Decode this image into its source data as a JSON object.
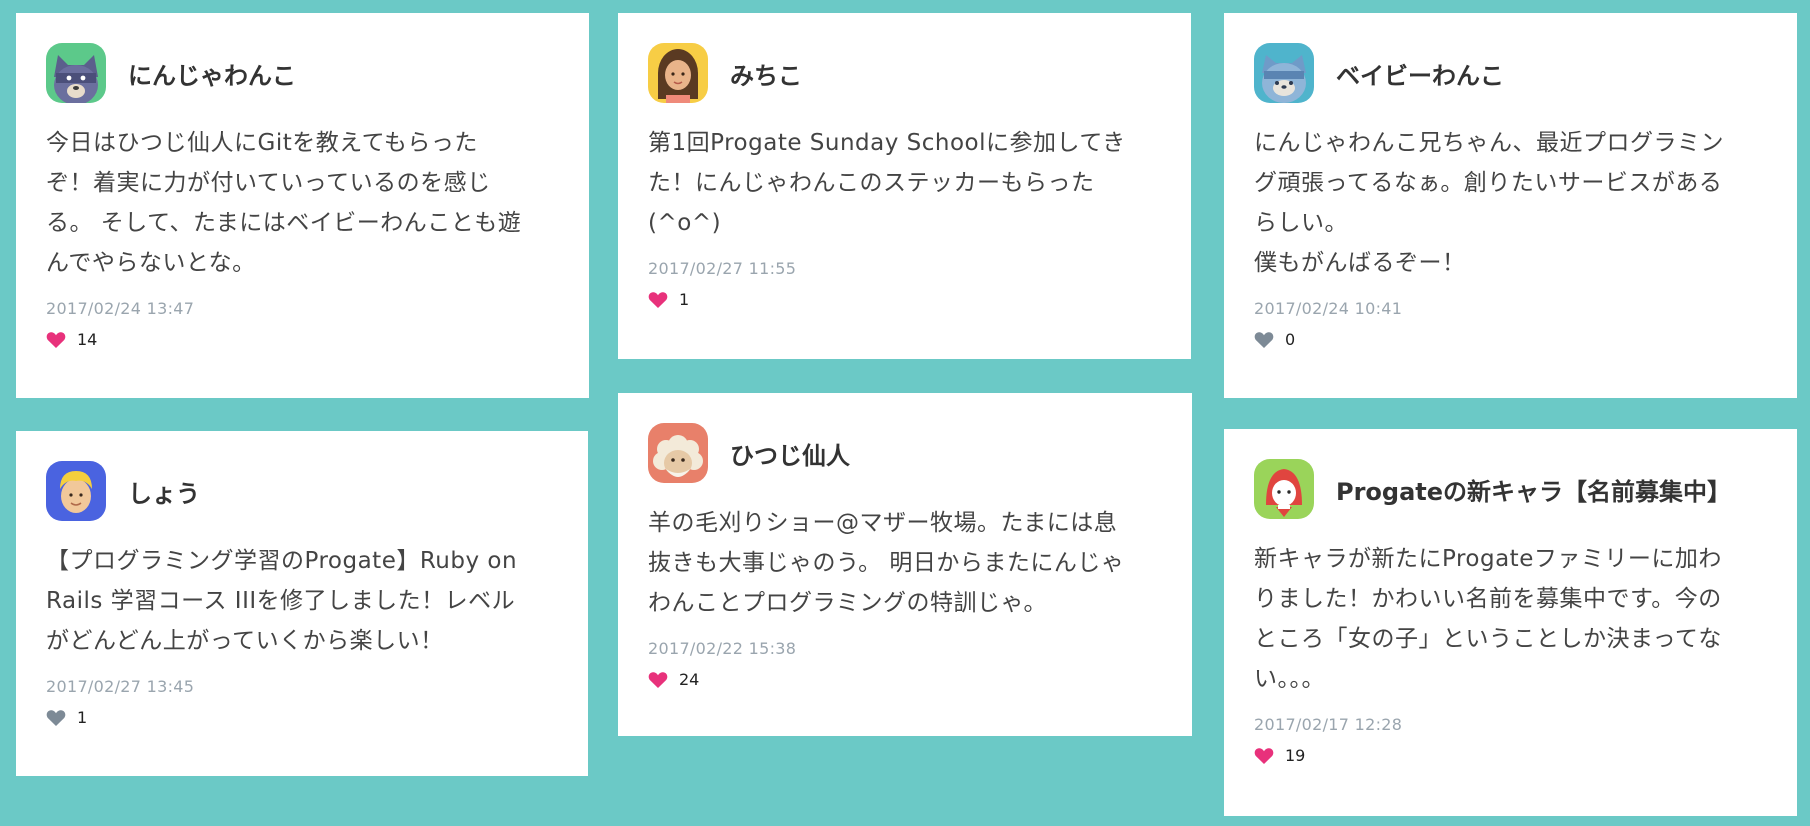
{
  "colors": {
    "background": "#6bc9c6",
    "liked_heart": "#e8317b",
    "unliked_heart": "#7d8a96"
  },
  "posts": [
    {
      "user": "にんじゃわんこ",
      "avatar_icon": "ninja-wanko-icon",
      "body": "今日はひつじ仙人にGitを教えてもらった\nぞ！着実に力が付いていっているのを感じ\nる。 そして、たまにはベイビーわんことも遊\nんでやらないとな。",
      "date": "2017/02/24 13:47",
      "likes": "14",
      "liked": true
    },
    {
      "user": "みちこ",
      "avatar_icon": "michiko-icon",
      "body": "第1回Progate Sunday Schoolに参加してき\nた！にんじゃわんこのステッカーもらった\n(^o^)",
      "date": "2017/02/27 11:55",
      "likes": "1",
      "liked": true
    },
    {
      "user": "ベイビーわんこ",
      "avatar_icon": "baby-wanko-icon",
      "body": "にんじゃわんこ兄ちゃん、最近プログラミン\nグ頑張ってるなぁ。創りたいサービスがある\nらしい。\n僕もがんばるぞー！",
      "date": "2017/02/24 10:41",
      "likes": "0",
      "liked": false
    },
    {
      "user": "しょう",
      "avatar_icon": "sho-icon",
      "body": "【プログラミング学習のProgate】Ruby on\nRails 学習コース IIIを修了しました！レベル\nがどんどん上がっていくから楽しい！",
      "date": "2017/02/27 13:45",
      "likes": "1",
      "liked": false
    },
    {
      "user": "ひつじ仙人",
      "avatar_icon": "hitsuji-sennin-icon",
      "body": "羊の毛刈りショー@マザー牧場。たまには息\n抜きも大事じゃのう。 明日からまたにんじゃ\nわんことプログラミングの特訓じゃ。",
      "date": "2017/02/22 15:38",
      "likes": "24",
      "liked": true
    },
    {
      "user": "Progateの新キャラ【名前募集中】",
      "avatar_icon": "new-character-icon",
      "body": "新キャラが新たにProgateファミリーに加わ\nりました！かわいい名前を募集中です。今の\nところ「女の子」ということしか決まってな\nい。。。",
      "date": "2017/02/17 12:28",
      "likes": "19",
      "liked": true
    }
  ]
}
